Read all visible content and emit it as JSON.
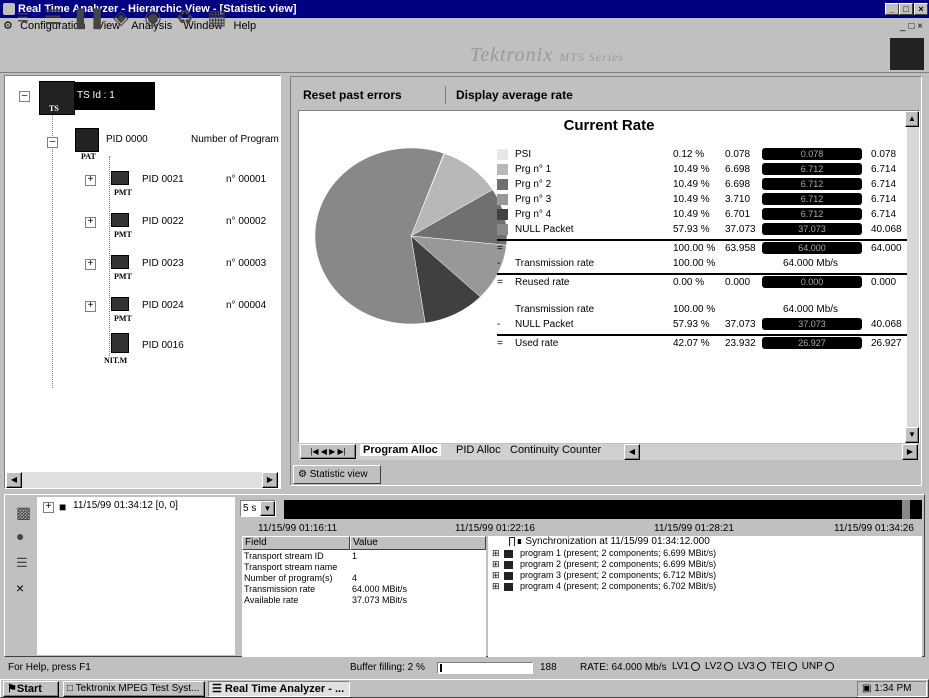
{
  "window": {
    "title": "Real Time Analyzer - Hierarchic View - [Statistic view]"
  },
  "menu": [
    "Configuration",
    "View",
    "Analysis",
    "Window",
    "Help"
  ],
  "brand": {
    "name": "Tektronix",
    "series": "MTS Series"
  },
  "tree": {
    "root": {
      "label": "TS Id :  1",
      "icon_text": "TS"
    },
    "pat": {
      "label": "PID 0000",
      "info": "Number of Programs",
      "icon_text": "PAT"
    },
    "pmts": [
      {
        "label": "PID 0021",
        "info": "n° 00001",
        "icon_text": "PMT"
      },
      {
        "label": "PID 0022",
        "info": "n° 00002",
        "icon_text": "PMT"
      },
      {
        "label": "PID 0023",
        "info": "n° 00003",
        "icon_text": "PMT"
      },
      {
        "label": "PID 0024",
        "info": "n° 00004",
        "icon_text": "PMT"
      }
    ],
    "nit": {
      "label": "PID 0016",
      "icon_text": "NIT.M"
    }
  },
  "panel": {
    "reset_button": "Reset past errors",
    "avg_button": "Display average rate",
    "heading": "Current Rate",
    "tabs": [
      "Program Alloc",
      "PID Alloc",
      "Continuity Counter"
    ],
    "window_tab": "Statistic view"
  },
  "rates": [
    {
      "name": "PSI",
      "pct": "0.12 %",
      "val": "0.078",
      "bar": "0.078",
      "max": "0.078",
      "color": "#e8e8e8"
    },
    {
      "name": "Prg n° 1",
      "pct": "10.49 %",
      "val": "6.698",
      "bar": "6.712",
      "max": "6.714",
      "color": "#b8b8b8"
    },
    {
      "name": "Prg n° 2",
      "pct": "10.49 %",
      "val": "6.698",
      "bar": "6.712",
      "max": "6.714",
      "color": "#707070"
    },
    {
      "name": "Prg n° 3",
      "pct": "10.49 %",
      "val": "3.710",
      "bar": "6.712",
      "max": "6.714",
      "color": "#989898"
    },
    {
      "name": "Prg n° 4",
      "pct": "10.49 %",
      "val": "6.701",
      "bar": "6.712",
      "max": "6.714",
      "color": "#404040"
    },
    {
      "name": "NULL Packet",
      "pct": "57.93 %",
      "val": "37.073",
      "bar": "37.073",
      "max": "40.068",
      "color": "#888888"
    }
  ],
  "summary": [
    {
      "sym": "=",
      "name": "",
      "pct": "100.00 %",
      "val": "63.958",
      "bar": "64.000",
      "max": "64.000"
    },
    {
      "sym": "-",
      "name": "Transmission rate",
      "pct": "100.00 %",
      "val": "",
      "bar": "64.000 Mb/s",
      "max": ""
    },
    {
      "sym": "=",
      "name": "Reused rate",
      "pct": "0.00 %",
      "val": "0.000",
      "bar": "0.000",
      "max": "0.000"
    },
    {
      "sym": "",
      "name": "Transmission rate",
      "pct": "100.00 %",
      "val": "",
      "bar": "64.000 Mb/s",
      "max": ""
    },
    {
      "sym": "-",
      "name": "NULL Packet",
      "pct": "57.93 %",
      "val": "37.073",
      "bar": "37.073",
      "max": "40.068"
    },
    {
      "sym": "=",
      "name": "Used rate",
      "pct": "42.07 %",
      "val": "23.932",
      "bar": "26.927",
      "max": "26.927"
    }
  ],
  "log": {
    "entry": "11/15/99 01:34:12  [0, 0]",
    "interval": "5 s",
    "times": [
      "11/15/99 01:16:11",
      "11/15/99 01:22:16",
      "11/15/99 01:28:21",
      "11/15/99 01:34:26"
    ],
    "field_header": "Field",
    "value_header": "Value",
    "fields": [
      {
        "f": "Transport stream ID",
        "v": "1"
      },
      {
        "f": "Transport stream name",
        "v": ""
      },
      {
        "f": "Number of program(s)",
        "v": "4"
      },
      {
        "f": "Transmission rate",
        "v": "64.000 MBit/s"
      },
      {
        "f": "Available rate",
        "v": "37.073 MBit/s"
      }
    ],
    "sync": "Synchronization at 11/15/99 01:34:12.000",
    "programs": [
      "program 1 (present; 2 components; 6.699 MBit/s)",
      "program 2 (present; 2 components; 6.699 MBit/s)",
      "program 3 (present; 2 components; 6.712 MBit/s)",
      "program 4 (present; 2 components; 6.702 MBit/s)"
    ]
  },
  "status": {
    "help": "For Help, press F1",
    "buffer": "Buffer filling: 2 %",
    "count": "188",
    "rate": "RATE: 64.000 Mb/s",
    "lv1": "LV1",
    "lv2": "LV2",
    "lv3": "LV3",
    "tei": "TEI",
    "unp": "UNP"
  },
  "taskbar": {
    "start": "Start",
    "task1": "Tektronix MPEG Test Syst...",
    "task2": "Real Time Analyzer - ...",
    "clock": "1:34 PM"
  },
  "pie_slices": [
    0.12,
    10.49,
    10.49,
    10.49,
    10.49,
    57.93
  ]
}
